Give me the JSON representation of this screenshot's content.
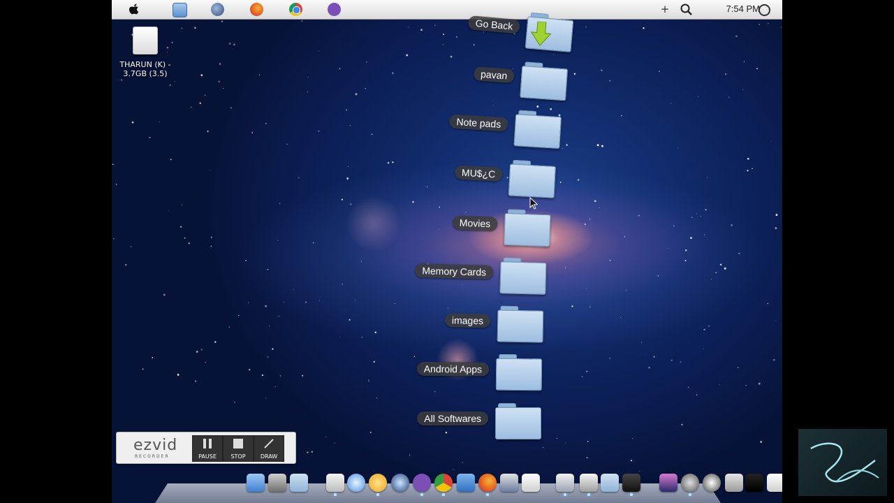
{
  "menubar": {
    "clock": "7:54 PM",
    "icons": [
      "apple-icon",
      "finder-icon",
      "globe-icon",
      "firefox-icon",
      "chrome-icon",
      "viber-icon",
      "plus-icon",
      "spotlight-icon",
      "power-icon"
    ]
  },
  "desktop": {
    "drive_label_line1": "THARUN (K) -",
    "drive_label_line2": "3.7GB (3.5)"
  },
  "stack": {
    "items": [
      {
        "label": "Go Back"
      },
      {
        "label": "pavan"
      },
      {
        "label": "Note pads"
      },
      {
        "label": "MU$¿C"
      },
      {
        "label": "Movies"
      },
      {
        "label": "Memory Cards"
      },
      {
        "label": "images"
      },
      {
        "label": "Android Apps"
      },
      {
        "label": "All Softwares"
      }
    ]
  },
  "ezvid": {
    "logo": "ezvid",
    "sub": "RECORDER",
    "pause": "PAUSE",
    "stop": "STOP",
    "draw": "DRAW"
  },
  "dock": {
    "icons": [
      "finder-icon",
      "utility-icon",
      "folder-icon",
      "document-icon",
      "safari-icon",
      "media-player-icon",
      "quicktime-icon",
      "viber-icon",
      "chrome-icon",
      "books-icon",
      "firefox-icon",
      "photos-icon",
      "notes-icon",
      "preview-icon",
      "scripts-icon",
      "downloads-icon",
      "dashboard-icon",
      "galaxy-icon",
      "disk-utility-icon",
      "time-icon",
      "trash-icon",
      "screen-icon",
      "keyboard-icon"
    ],
    "colors": {
      "firefox": "#e8621d",
      "chrome": "#2f9e44",
      "viber": "#7b4fb5",
      "media": "#f0a21a",
      "accent": "#4a8fe0"
    }
  }
}
